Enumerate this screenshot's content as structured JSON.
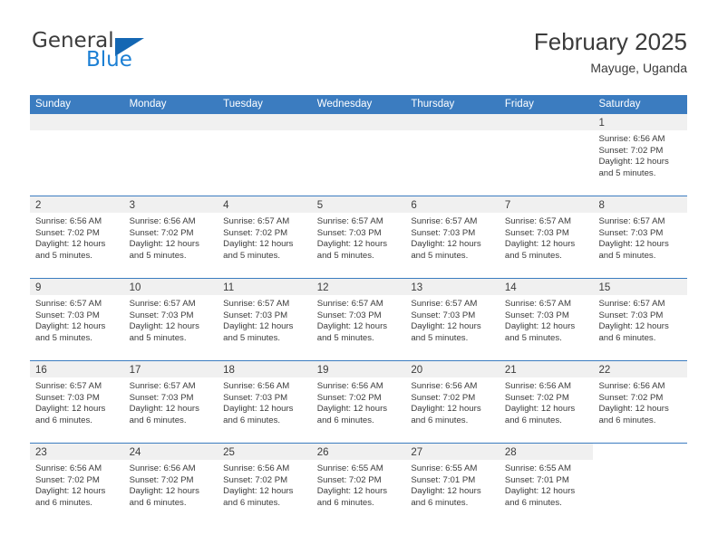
{
  "brand": {
    "name_top": "General",
    "name_bottom": "Blue",
    "accent_color": "#1467b3",
    "blue_text_color": "#1b7fd4"
  },
  "header": {
    "title": "February 2025",
    "location": "Mayuge, Uganda"
  },
  "calendar": {
    "header_bg": "#3b7cc0",
    "day_band_bg": "#f0f0f0",
    "weekdays": [
      "Sunday",
      "Monday",
      "Tuesday",
      "Wednesday",
      "Thursday",
      "Friday",
      "Saturday"
    ],
    "weeks": [
      [
        {
          "day": "",
          "sunrise": "",
          "sunset": "",
          "daylight_line1": "",
          "daylight_line2": "",
          "blank": true
        },
        {
          "day": "",
          "sunrise": "",
          "sunset": "",
          "daylight_line1": "",
          "daylight_line2": "",
          "blank": true
        },
        {
          "day": "",
          "sunrise": "",
          "sunset": "",
          "daylight_line1": "",
          "daylight_line2": "",
          "blank": true
        },
        {
          "day": "",
          "sunrise": "",
          "sunset": "",
          "daylight_line1": "",
          "daylight_line2": "",
          "blank": true
        },
        {
          "day": "",
          "sunrise": "",
          "sunset": "",
          "daylight_line1": "",
          "daylight_line2": "",
          "blank": true
        },
        {
          "day": "",
          "sunrise": "",
          "sunset": "",
          "daylight_line1": "",
          "daylight_line2": "",
          "blank": true
        },
        {
          "day": "1",
          "sunrise": "Sunrise: 6:56 AM",
          "sunset": "Sunset: 7:02 PM",
          "daylight_line1": "Daylight: 12 hours",
          "daylight_line2": "and 5 minutes."
        }
      ],
      [
        {
          "day": "2",
          "sunrise": "Sunrise: 6:56 AM",
          "sunset": "Sunset: 7:02 PM",
          "daylight_line1": "Daylight: 12 hours",
          "daylight_line2": "and 5 minutes."
        },
        {
          "day": "3",
          "sunrise": "Sunrise: 6:56 AM",
          "sunset": "Sunset: 7:02 PM",
          "daylight_line1": "Daylight: 12 hours",
          "daylight_line2": "and 5 minutes."
        },
        {
          "day": "4",
          "sunrise": "Sunrise: 6:57 AM",
          "sunset": "Sunset: 7:02 PM",
          "daylight_line1": "Daylight: 12 hours",
          "daylight_line2": "and 5 minutes."
        },
        {
          "day": "5",
          "sunrise": "Sunrise: 6:57 AM",
          "sunset": "Sunset: 7:03 PM",
          "daylight_line1": "Daylight: 12 hours",
          "daylight_line2": "and 5 minutes."
        },
        {
          "day": "6",
          "sunrise": "Sunrise: 6:57 AM",
          "sunset": "Sunset: 7:03 PM",
          "daylight_line1": "Daylight: 12 hours",
          "daylight_line2": "and 5 minutes."
        },
        {
          "day": "7",
          "sunrise": "Sunrise: 6:57 AM",
          "sunset": "Sunset: 7:03 PM",
          "daylight_line1": "Daylight: 12 hours",
          "daylight_line2": "and 5 minutes."
        },
        {
          "day": "8",
          "sunrise": "Sunrise: 6:57 AM",
          "sunset": "Sunset: 7:03 PM",
          "daylight_line1": "Daylight: 12 hours",
          "daylight_line2": "and 5 minutes."
        }
      ],
      [
        {
          "day": "9",
          "sunrise": "Sunrise: 6:57 AM",
          "sunset": "Sunset: 7:03 PM",
          "daylight_line1": "Daylight: 12 hours",
          "daylight_line2": "and 5 minutes."
        },
        {
          "day": "10",
          "sunrise": "Sunrise: 6:57 AM",
          "sunset": "Sunset: 7:03 PM",
          "daylight_line1": "Daylight: 12 hours",
          "daylight_line2": "and 5 minutes."
        },
        {
          "day": "11",
          "sunrise": "Sunrise: 6:57 AM",
          "sunset": "Sunset: 7:03 PM",
          "daylight_line1": "Daylight: 12 hours",
          "daylight_line2": "and 5 minutes."
        },
        {
          "day": "12",
          "sunrise": "Sunrise: 6:57 AM",
          "sunset": "Sunset: 7:03 PM",
          "daylight_line1": "Daylight: 12 hours",
          "daylight_line2": "and 5 minutes."
        },
        {
          "day": "13",
          "sunrise": "Sunrise: 6:57 AM",
          "sunset": "Sunset: 7:03 PM",
          "daylight_line1": "Daylight: 12 hours",
          "daylight_line2": "and 5 minutes."
        },
        {
          "day": "14",
          "sunrise": "Sunrise: 6:57 AM",
          "sunset": "Sunset: 7:03 PM",
          "daylight_line1": "Daylight: 12 hours",
          "daylight_line2": "and 5 minutes."
        },
        {
          "day": "15",
          "sunrise": "Sunrise: 6:57 AM",
          "sunset": "Sunset: 7:03 PM",
          "daylight_line1": "Daylight: 12 hours",
          "daylight_line2": "and 6 minutes."
        }
      ],
      [
        {
          "day": "16",
          "sunrise": "Sunrise: 6:57 AM",
          "sunset": "Sunset: 7:03 PM",
          "daylight_line1": "Daylight: 12 hours",
          "daylight_line2": "and 6 minutes."
        },
        {
          "day": "17",
          "sunrise": "Sunrise: 6:57 AM",
          "sunset": "Sunset: 7:03 PM",
          "daylight_line1": "Daylight: 12 hours",
          "daylight_line2": "and 6 minutes."
        },
        {
          "day": "18",
          "sunrise": "Sunrise: 6:56 AM",
          "sunset": "Sunset: 7:03 PM",
          "daylight_line1": "Daylight: 12 hours",
          "daylight_line2": "and 6 minutes."
        },
        {
          "day": "19",
          "sunrise": "Sunrise: 6:56 AM",
          "sunset": "Sunset: 7:02 PM",
          "daylight_line1": "Daylight: 12 hours",
          "daylight_line2": "and 6 minutes."
        },
        {
          "day": "20",
          "sunrise": "Sunrise: 6:56 AM",
          "sunset": "Sunset: 7:02 PM",
          "daylight_line1": "Daylight: 12 hours",
          "daylight_line2": "and 6 minutes."
        },
        {
          "day": "21",
          "sunrise": "Sunrise: 6:56 AM",
          "sunset": "Sunset: 7:02 PM",
          "daylight_line1": "Daylight: 12 hours",
          "daylight_line2": "and 6 minutes."
        },
        {
          "day": "22",
          "sunrise": "Sunrise: 6:56 AM",
          "sunset": "Sunset: 7:02 PM",
          "daylight_line1": "Daylight: 12 hours",
          "daylight_line2": "and 6 minutes."
        }
      ],
      [
        {
          "day": "23",
          "sunrise": "Sunrise: 6:56 AM",
          "sunset": "Sunset: 7:02 PM",
          "daylight_line1": "Daylight: 12 hours",
          "daylight_line2": "and 6 minutes."
        },
        {
          "day": "24",
          "sunrise": "Sunrise: 6:56 AM",
          "sunset": "Sunset: 7:02 PM",
          "daylight_line1": "Daylight: 12 hours",
          "daylight_line2": "and 6 minutes."
        },
        {
          "day": "25",
          "sunrise": "Sunrise: 6:56 AM",
          "sunset": "Sunset: 7:02 PM",
          "daylight_line1": "Daylight: 12 hours",
          "daylight_line2": "and 6 minutes."
        },
        {
          "day": "26",
          "sunrise": "Sunrise: 6:55 AM",
          "sunset": "Sunset: 7:02 PM",
          "daylight_line1": "Daylight: 12 hours",
          "daylight_line2": "and 6 minutes."
        },
        {
          "day": "27",
          "sunrise": "Sunrise: 6:55 AM",
          "sunset": "Sunset: 7:01 PM",
          "daylight_line1": "Daylight: 12 hours",
          "daylight_line2": "and 6 minutes."
        },
        {
          "day": "28",
          "sunrise": "Sunrise: 6:55 AM",
          "sunset": "Sunset: 7:01 PM",
          "daylight_line1": "Daylight: 12 hours",
          "daylight_line2": "and 6 minutes."
        },
        {
          "day": "",
          "sunrise": "",
          "sunset": "",
          "daylight_line1": "",
          "daylight_line2": "",
          "blank": true
        }
      ]
    ]
  }
}
